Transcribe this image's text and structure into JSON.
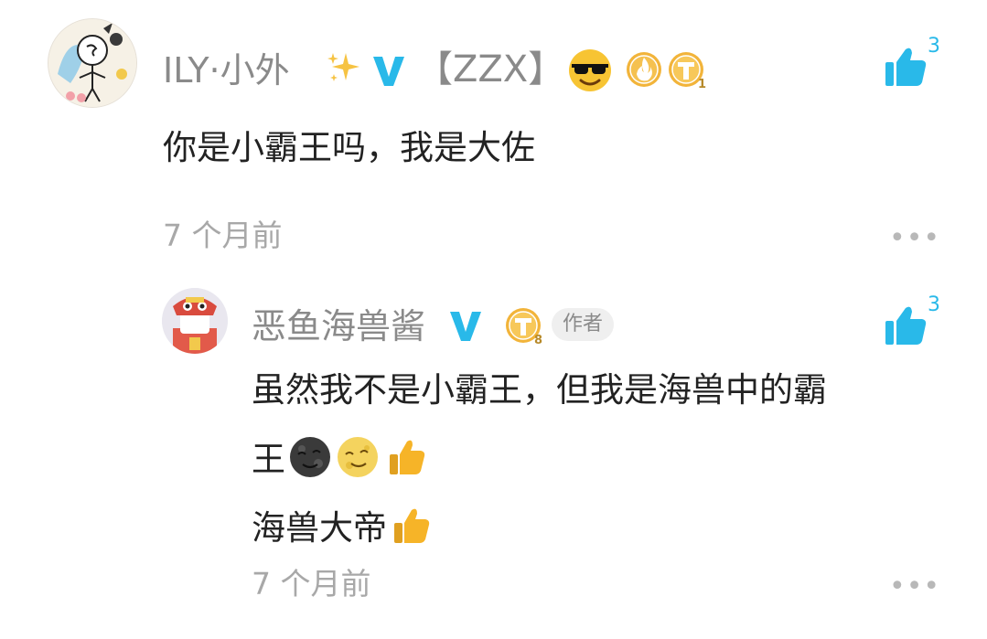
{
  "comment": {
    "user": {
      "name_prefix": "ILY·小外",
      "tag": "【ZZX】"
    },
    "text": "你是小霸王吗，我是大佐",
    "time": "7 个月前",
    "like_count": "3",
    "more": "•••"
  },
  "reply": {
    "user": {
      "name": "恶鱼海兽酱",
      "author_label": "作者"
    },
    "text_line1": "虽然我不是小霸王，但我是海兽中的霸",
    "text_line2": "王",
    "text_line3": "海兽大帝",
    "time": "7 个月前",
    "like_count": "3",
    "more": "•••"
  },
  "colors": {
    "accent": "#29b9e9",
    "gold": "#f2b43a",
    "text": "#222222",
    "muted": "#8a8a8a"
  },
  "icons": [
    "thumbs-up-icon",
    "v-verified-icon",
    "sparkles-icon",
    "sunglasses-emoji-icon",
    "flame-medal-icon",
    "t-coin-icon",
    "more-icon"
  ]
}
